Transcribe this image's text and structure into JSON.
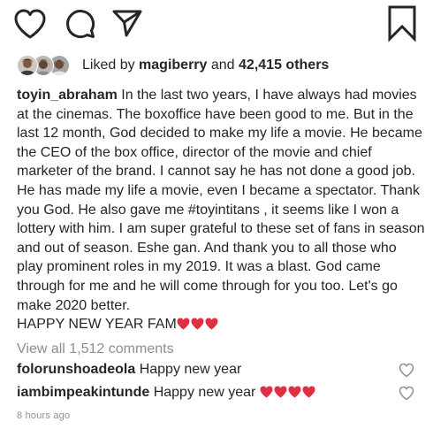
{
  "actions": {
    "like_icon": "heart-outline-icon",
    "comment_icon": "speech-bubble-icon",
    "share_icon": "paper-plane-icon",
    "save_icon": "bookmark-icon"
  },
  "likes": {
    "prefix": "Liked by",
    "first_user": "magiberry",
    "joiner": "and",
    "others": "42,415 others"
  },
  "post": {
    "username": "toyin_abraham",
    "caption": "In the last two years, I have always had movies at the cinemas. The boxoffice have been good to me. But in the last 12 month, God decided to make my life a movie. He became the CEO of the box office, director of the movie and chief marketer of the brand. I cannot say he has not done a good job. He has made my life a movie, even I became a spectator.  Thank you God. He also gave me #toyintitans , it seems like I won a lottery with him. I am super grateful to these set of fans in season and out of season. Eshe gan. And thank you to all those who play prominent roles in my 2019. It was a blast. God came through for me and he will come through for you too. Let's go make 2020 better.",
    "closing": "HAPPY NEW YEAR FAM"
  },
  "comments": {
    "view_all": "View all 1,512 comments",
    "items": [
      {
        "username": "folorunshoadeola",
        "text": "Happy new year"
      },
      {
        "username": "iambimpeakintunde",
        "text": "Happy new year"
      }
    ]
  },
  "timestamp": "8 hours ago",
  "colors": {
    "text": "#262626",
    "muted": "#8e8e8e",
    "heart_emoji": "#dd2e44"
  }
}
